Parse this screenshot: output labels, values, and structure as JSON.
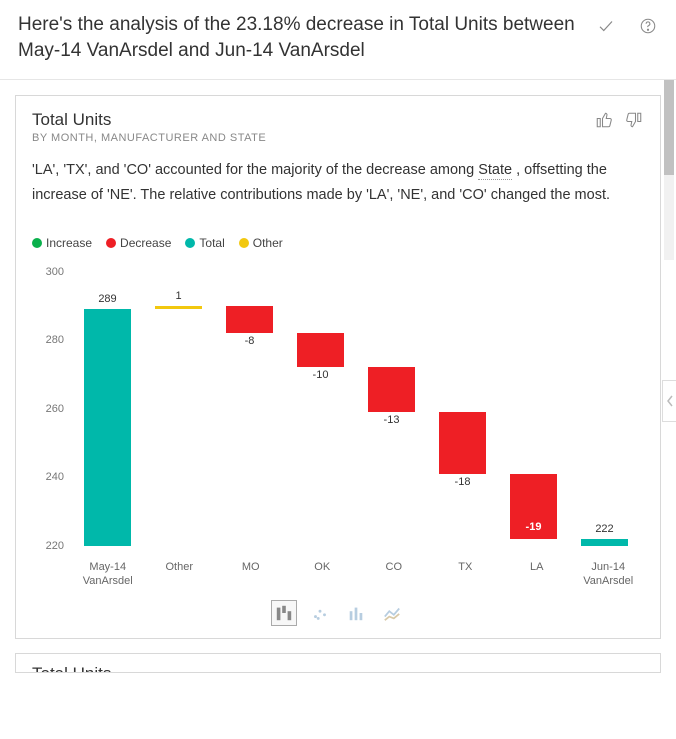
{
  "header": {
    "title": "Here's the analysis of the 23.18% decrease in Total Units between May-14 VanArsdel and Jun-14 VanArsdel"
  },
  "card": {
    "title": "Total Units",
    "subtitle": "BY MONTH, MANUFACTURER AND STATE",
    "explain_pre": "'LA', 'TX', and 'CO' accounted for the majority of the decrease among ",
    "explain_link": "State",
    "explain_post": " , offsetting the increase of 'NE'. The relative contributions made by 'LA', 'NE', and 'CO' changed the most."
  },
  "legend": {
    "increase": "Increase",
    "decrease": "Decrease",
    "total": "Total",
    "other": "Other"
  },
  "colors": {
    "increase": "#0ab04c",
    "decrease": "#ee1f25",
    "total": "#00b8aa",
    "other": "#f2c80f"
  },
  "chart_data": {
    "type": "bar",
    "title": "Total Units by Month, Manufacturer and State",
    "ylabel": "",
    "xlabel": "",
    "ylim": [
      220,
      300
    ],
    "yticks": [
      220,
      240,
      260,
      280,
      300
    ],
    "categories": [
      "May-14 VanArsdel",
      "Other",
      "MO",
      "OK",
      "CO",
      "TX",
      "LA",
      "Jun-14 VanArsdel"
    ],
    "series": [
      {
        "name": "waterfall",
        "kind": [
          "total",
          "other",
          "decrease",
          "decrease",
          "decrease",
          "decrease",
          "decrease",
          "total"
        ],
        "delta": [
          289,
          1,
          -8,
          -10,
          -13,
          -18,
          -19,
          222
        ],
        "cumulative_top": [
          289,
          290,
          290,
          282,
          272,
          259,
          241,
          222
        ]
      }
    ],
    "labels": [
      "289",
      "1",
      "-8",
      "-10",
      "-13",
      "-18",
      "-19",
      "222"
    ]
  },
  "card2": {
    "title": "Total Units"
  }
}
